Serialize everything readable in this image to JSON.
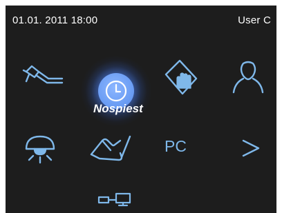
{
  "status_bar": {
    "datetime": "01.01. 2011 18:00",
    "user": "User C"
  },
  "menu": {
    "selected_label": "Nospiest",
    "pc_label": "PC"
  },
  "icons": [
    "handpiece-icon",
    "clock-icon",
    "touch-screen-icon",
    "user-icon",
    "operating-light-icon",
    "foot-pedal-icon",
    "pc-icon",
    "next-arrow-icon",
    "network-connection-icon"
  ],
  "colors": {
    "background": "#1d1d1d",
    "icon": "#7fb8ea",
    "highlight": "#6c9ef4",
    "text": "#ffffff"
  }
}
